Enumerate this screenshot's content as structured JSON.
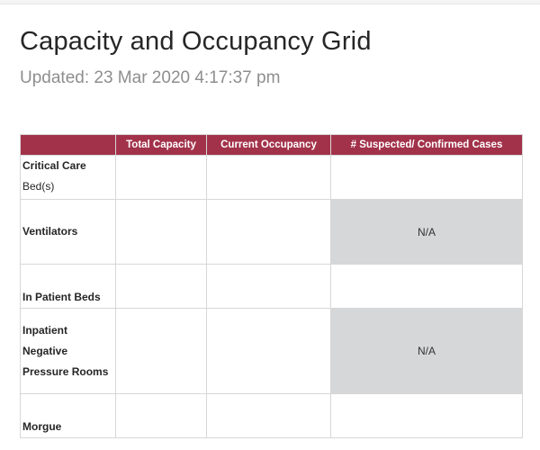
{
  "page": {
    "title": "Capacity and Occupancy Grid",
    "updated": "Updated: 23 Mar 2020 4:17:37 pm"
  },
  "table": {
    "columns": [
      "",
      "Total Capacity",
      "Current Occupancy",
      "# Suspected/ Confirmed Cases"
    ],
    "rows": [
      {
        "label_line1": "Critical Care",
        "label_line2": "Bed(s)",
        "total_capacity": "",
        "current_occupancy": "",
        "cases": ""
      },
      {
        "label": "Ventilators",
        "total_capacity": "",
        "current_occupancy": "",
        "cases": "N/A"
      },
      {
        "label": "In Patient Beds",
        "total_capacity": "",
        "current_occupancy": "",
        "cases": ""
      },
      {
        "label_line1": "Inpatient",
        "label_line2": "Negative",
        "label_line3": "Pressure Rooms",
        "total_capacity": "",
        "current_occupancy": "",
        "cases": "N/A"
      },
      {
        "label": "Morgue",
        "total_capacity": "",
        "current_occupancy": "",
        "cases": ""
      }
    ]
  },
  "colors": {
    "header_bg": "#a2324a",
    "header_text": "#ffffff",
    "na_cell_bg": "#d5d7d8",
    "title_text": "#262626",
    "updated_text": "#8e8e8e"
  }
}
